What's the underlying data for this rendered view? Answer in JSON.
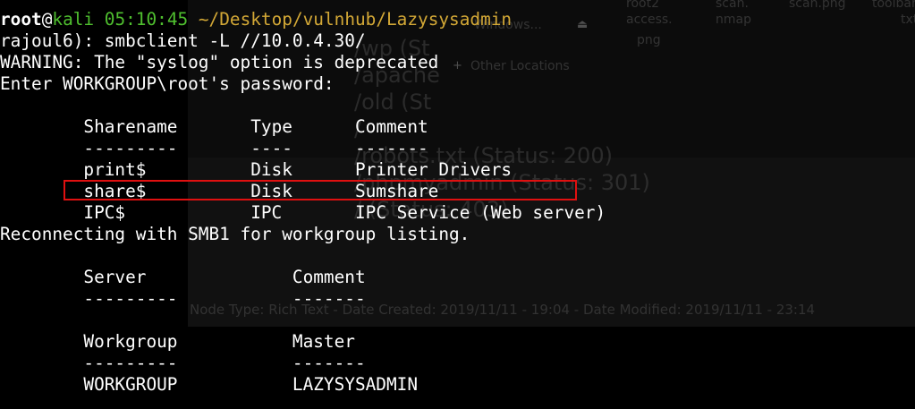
{
  "background": {
    "ghost_lines": [
      "/wp (St",
      "/apache",
      "/old (St",
      "/",
      "/robots.txt (Status: 200)",
      "/phpmyadmin (Status: 301)",
      "/ (Status: 403)"
    ],
    "file_labels": [
      "root2",
      "scan.",
      "scan.png",
      "toolbar",
      "access.",
      "nmap",
      "txt",
      "png"
    ],
    "sidebar_items": [
      "Windows...",
      "Other Locations"
    ],
    "status_bar": "Node Type: Rich Text  -  Date Created: 2019/11/11 - 19:04  -  Date Modified: 2019/11/11 - 23:14"
  },
  "terminal": {
    "prompt": {
      "user": "root",
      "at": "@",
      "host": "kali",
      "time": "05:10:45",
      "path": "~/Desktop/vulnhub/Lazysysadmin"
    },
    "command_line": "rajoul6): smbclient -L //10.0.4.30/",
    "warning": "WARNING: The \"syslog\" option is deprecated",
    "password_prompt": "Enter WORKGROUP\\root's password:",
    "shares_table": {
      "headers": [
        "Sharename",
        "Type",
        "Comment"
      ],
      "underline": [
        "---------",
        "----",
        "-------"
      ],
      "rows": [
        [
          "print$",
          "Disk",
          "Printer Drivers"
        ],
        [
          "share$",
          "Disk",
          "Sumshare"
        ],
        [
          "IPC$",
          "IPC",
          "IPC Service (Web server)"
        ]
      ]
    },
    "reconnect": "Reconnecting with SMB1 for workgroup listing.",
    "server_table": {
      "headers": [
        "Server",
        "Comment"
      ],
      "underline": [
        "---------",
        "-------"
      ]
    },
    "workgroup_table": {
      "headers": [
        "Workgroup",
        "Master"
      ],
      "underline": [
        "---------",
        "-------"
      ],
      "rows": [
        [
          "WORKGROUP",
          "LAZYSYSADMIN"
        ]
      ]
    }
  },
  "colors": {
    "host": "#4fbf2f",
    "path": "#d3a836",
    "highlight": "#e01010"
  }
}
